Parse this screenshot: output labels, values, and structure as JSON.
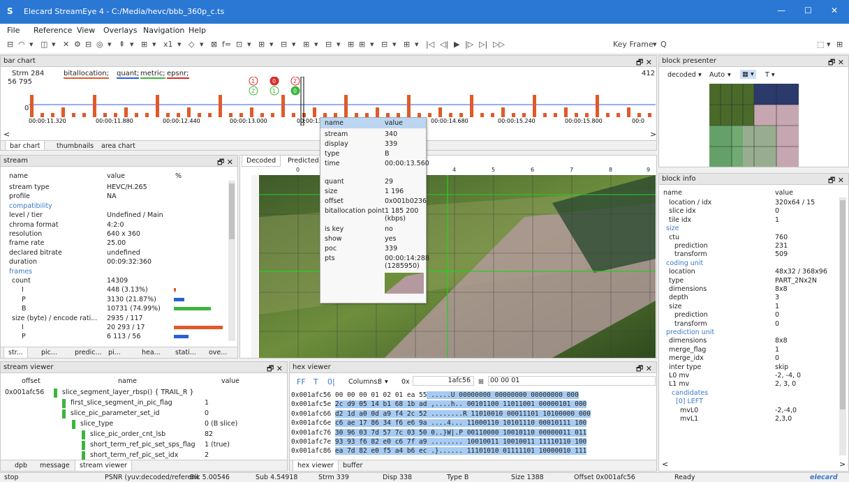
{
  "window": {
    "logo": "S",
    "title": "Elecard StreamEye 4 - C:/Media/hevc/bbb_360p_c.ts",
    "min": "—",
    "max": "☐",
    "close": "✕"
  },
  "menu": [
    "File",
    "Reference",
    "View",
    "Overlays",
    "Navigation",
    "Help"
  ],
  "toolbar": {
    "icons": [
      "⊟",
      "◠",
      "▾",
      "◫",
      "▾",
      "✕",
      "⚙",
      "⊟",
      "◎",
      "▾",
      "⇞",
      "▾",
      "⊞",
      "▾",
      "x1",
      "▾",
      "◇",
      "▾",
      "⊠",
      "f=",
      "⊡",
      "▾",
      "⊞",
      "▾",
      "⊟",
      "▾",
      "⊞",
      "▾",
      "⊟",
      "▾",
      "⊞",
      "⊞",
      "▾",
      "⊟",
      "▾",
      "⊞",
      "▾",
      "|◁",
      "◁|",
      "▶",
      "|▷",
      "▷|",
      "▷▷"
    ],
    "keyframe": "Key Frame",
    "search": "Q",
    "right1": "⬚",
    "right2": "▾",
    "right3": "⊞"
  },
  "barchart": {
    "header": "bar chart",
    "strm": "Strm 284",
    "legend": {
      "a": "bitallocation;",
      "b": "quant;",
      "c": "metric;",
      "d": "epsnr;"
    },
    "ymax": "56 795",
    "yzero": "0",
    "right_num": "412",
    "times": [
      "00:00:11.320",
      "00:00:11.880",
      "00:00:12.440",
      "00:00:13.000",
      "00:00:13.560",
      "00:00:14.120",
      "00:00:14.680",
      "00:00:15.240",
      "00:00:15.800",
      "00:0"
    ],
    "markers": [
      "1",
      "0",
      "2",
      "2",
      "1",
      "0"
    ],
    "tabs": [
      "bar chart",
      "thumbnails",
      "area chart"
    ]
  },
  "tooltip": {
    "h_name": "name",
    "h_value": "value",
    "rows": [
      [
        "stream",
        "340"
      ],
      [
        "display",
        "339"
      ],
      [
        "type",
        "B"
      ],
      [
        "time",
        "00:00:13.560"
      ],
      [
        "quant",
        "29"
      ],
      [
        "size",
        "1 196"
      ],
      [
        "offset",
        "0x001b0236"
      ],
      [
        "bitallocation point",
        "1 185 200 (kbps)"
      ],
      [
        "is key",
        "no"
      ],
      [
        "show",
        "yes"
      ],
      [
        "poc",
        "339"
      ],
      [
        "pts",
        "00:00:14:288 (1285950)"
      ]
    ]
  },
  "stream": {
    "header": "stream",
    "cols": [
      "name",
      "value",
      "%"
    ],
    "rows": [
      [
        "stream type",
        "HEVC/H.265",
        0
      ],
      [
        "profile",
        "NA",
        0
      ],
      [
        "compatibility",
        "",
        1
      ],
      [
        "level / tier",
        "Undefined / Main",
        0
      ],
      [
        "chroma format",
        "4:2:0",
        0
      ],
      [
        "resolution",
        "640 x 360",
        0
      ],
      [
        "frame rate",
        "25.00",
        0
      ],
      [
        "declared bitrate",
        "undefined",
        0
      ],
      [
        "duration",
        "00:09:32:360",
        0
      ],
      [
        "frames",
        "",
        1
      ],
      [
        "count",
        "14309",
        2
      ],
      [
        "I",
        "448 (3.13%)",
        3
      ],
      [
        "P",
        "3130 (21.87%)",
        3
      ],
      [
        "B",
        "10731 (74.99%)",
        3
      ],
      [
        "size (byte) / encode rati...",
        "2935 / 117",
        2
      ],
      [
        "I",
        "20 293 / 17",
        3
      ],
      [
        "P",
        "6 113 / 56",
        3
      ]
    ],
    "bars": {
      "I": 0.031,
      "P": 0.219,
      "B": 0.75,
      "I2": 1.0,
      "P2": 0.3
    },
    "tabs": [
      "str...",
      "pic...",
      "predic...",
      "pi...",
      "hea...",
      "stati...",
      "ove..."
    ]
  },
  "video": {
    "tabs": [
      "Decoded",
      "Predicted"
    ],
    "ruler": [
      "0",
      "4",
      "5",
      "6",
      "7",
      "8",
      "9"
    ]
  },
  "blockpresenter": {
    "header": "block presenter",
    "decoded": "decoded",
    "auto": "Auto"
  },
  "blockinfo": {
    "header": "block info",
    "cols": [
      "name",
      "value"
    ],
    "rows": [
      [
        "location / idx",
        "320x64 / 15",
        1
      ],
      [
        "slice idx",
        "0",
        1
      ],
      [
        "tile idx",
        "1",
        1
      ],
      [
        "size",
        "",
        0
      ],
      [
        "ctu",
        "760",
        1
      ],
      [
        "prediction",
        "231",
        2
      ],
      [
        "transform",
        "509",
        2
      ],
      [
        "coding unit",
        "",
        0
      ],
      [
        "location",
        "48x32 / 368x96",
        1
      ],
      [
        "type",
        "PART_2Nx2N",
        1
      ],
      [
        "dimensions",
        "8x8",
        1
      ],
      [
        "depth",
        "3",
        1
      ],
      [
        "size",
        "1",
        1
      ],
      [
        "prediction",
        "0",
        2
      ],
      [
        "transform",
        "0",
        2
      ],
      [
        "prediction unit",
        "",
        0
      ],
      [
        "dimensions",
        "8x8",
        1
      ],
      [
        "merge_flag",
        "1",
        1
      ],
      [
        "merge_idx",
        "0",
        1
      ],
      [
        "inter type",
        "skip",
        1
      ],
      [
        "L0 mv",
        "-2, -4, 0",
        1
      ],
      [
        "L1 mv",
        "2, 3, 0",
        1
      ],
      [
        "candidates",
        "",
        3
      ],
      [
        "[0] LEFT",
        "",
        4
      ],
      [
        "mvL0",
        "-2,-4,0",
        5
      ],
      [
        "mvL1",
        "2,3,0",
        5
      ]
    ]
  },
  "streamviewer": {
    "header": "stream viewer",
    "cols": [
      "offset",
      "name",
      "value"
    ],
    "rows": [
      [
        "0x001afc56",
        "slice_segment_layer_rbsp() { TRAIL_R }",
        "",
        0
      ],
      [
        "",
        "first_slice_segment_in_pic_flag",
        "1",
        1
      ],
      [
        "",
        "slice_pic_parameter_set_id",
        "0",
        1
      ],
      [
        "",
        "slice_type",
        "0 (B slice)",
        2
      ],
      [
        "",
        "slice_pic_order_cnt_lsb",
        "82",
        3
      ],
      [
        "",
        "short_term_ref_pic_set_sps_flag",
        "1 (true)",
        3
      ],
      [
        "",
        "short_term_ref_pic_set_idx",
        "2",
        3
      ]
    ],
    "tabs": [
      "dpb",
      "message",
      "stream viewer"
    ]
  },
  "hexviewer": {
    "header": "hex viewer",
    "ff": "FF",
    "t": "T",
    "o1": "0|",
    "columns_label": "Columns:",
    "columns_val": "8",
    "find1": "1afc56",
    "find2": "00 00 01",
    "rows": [
      [
        "0x001afc56",
        "00 00 00 01 02 01 ea 55",
        ".....U",
        "00000000 00000000 00000000 000"
      ],
      [
        "0x001afc5e",
        "2c d9 05 14 b1 68 1b ad",
        ",....h..",
        "00101100 11011001 00000101 000"
      ],
      [
        "0x001afc66",
        "d2 1d a0 0d a9 f4 2c 52",
        "........R",
        "11010010 00011101 10100000 000"
      ],
      [
        "0x001afc6e",
        "c6 ae 17 86 34 f6 e6 9a",
        "....4...",
        "11000110 10101110 00010111 100"
      ],
      [
        "0x001afc76",
        "30 96 03 7d 57 7c 03 50",
        "0..}W|.P",
        "00110000 10010110 00000011 011"
      ],
      [
        "0x001afc7e",
        "93 93 f6 82 e0 c6 7f a9",
        "........",
        "10010011 10010011 11110110 100"
      ],
      [
        "0x001afc86",
        "ea 7d 82 e0 f5 a4 b6 ec",
        ".}......",
        "11101010 01111101 10000010 111"
      ]
    ],
    "tabs": [
      "hex viewer",
      "buffer"
    ]
  },
  "status": {
    "stop": "stop",
    "psnr": "PSNR (yuv:decoded/referenc",
    "blk": "Blk 5.00546",
    "sub": "Sub 4.54918",
    "strm": "Strm 339",
    "disp": "Disp 338",
    "type": "Type B",
    "size": "Size 1388",
    "offset": "Offset 0x001afc56",
    "ready": "Ready",
    "brand": "elecard"
  },
  "colors": {
    "title_bg": "#2b78d4",
    "bitalloc": "#e05a2b",
    "quant": "#2b5fd9",
    "metric": "#3db53d",
    "epsnr": "#d92b2b"
  }
}
